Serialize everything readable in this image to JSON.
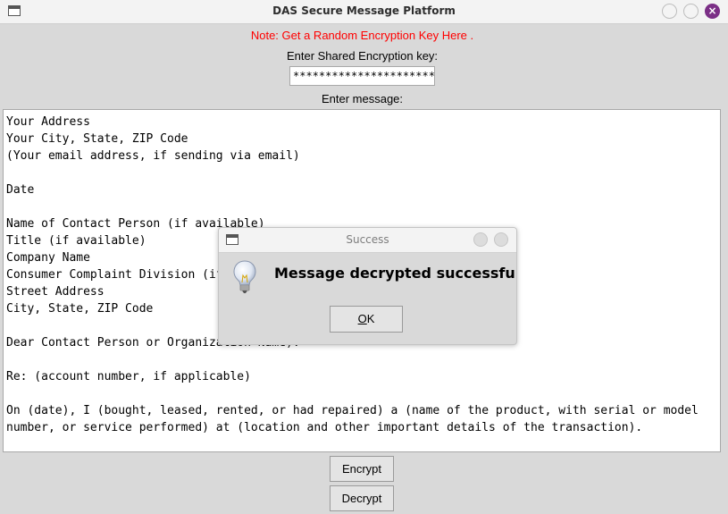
{
  "window": {
    "title": "DAS Secure Message Platform",
    "close_glyph": "×"
  },
  "header": {
    "note": "Note: Get a Random Encryption Key Here .",
    "note_color": "#ff0000",
    "key_label": "Enter Shared Encryption key:",
    "key_value": "**********************",
    "message_label": "Enter message:"
  },
  "message": {
    "lines": [
      "Your Address",
      "Your City, State, ZIP Code",
      "(Your email address, if sending via email)",
      "",
      "Date",
      "",
      "Name of Contact Person (if available)",
      "Title (if available)",
      "Company Name",
      "Consumer Complaint Division (if available)",
      "Street Address",
      "City, State, ZIP Code",
      "",
      "Dear Contact Person or Organization Name):",
      "",
      "Re: (account number, if applicable)",
      "",
      "On (date), I (bought, leased, rented, or had repaired) a (name of the product, with serial or model",
      "number, or service performed) at (location and other important details of the transaction)."
    ]
  },
  "buttons": {
    "encrypt": "Encrypt",
    "decrypt": "Decrypt"
  },
  "dialog": {
    "title": "Success",
    "message": "Message decrypted successfully!",
    "ok_mnemonic": "O",
    "ok_rest": "K",
    "icon": "lightbulb-icon"
  },
  "colors": {
    "close_button": "#7b2f86",
    "background": "#d9d9d9"
  }
}
